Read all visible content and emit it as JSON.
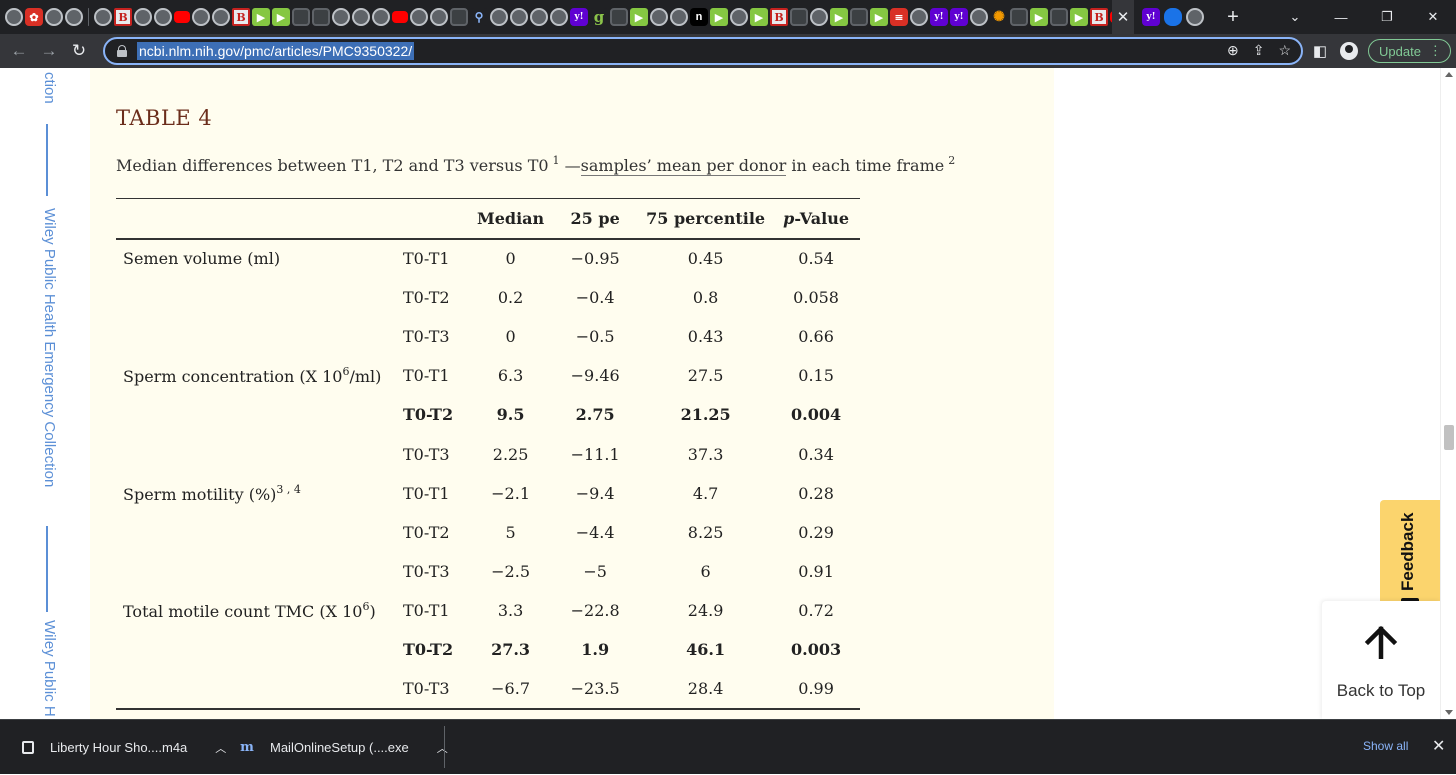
{
  "browser": {
    "url": "ncbi.nlm.nih.gov/pmc/articles/PMC9350322/",
    "update_label": "Update",
    "window_controls": [
      "⌄",
      "—",
      "❐",
      "✕"
    ],
    "new_tab_label": "+",
    "active_tab_close": "✕"
  },
  "sidebar": {
    "label_top": "ction",
    "label_mid": "Wiley Public Health Emergency Collection",
    "label_bottom": "Wiley Public H"
  },
  "article": {
    "table_title": "TABLE 4",
    "caption": {
      "text_before": "Median differences between T1, T2 and T3 versus T0",
      "sup1": "1",
      "dash": " —",
      "link": "samples’ mean per donor",
      "text_after": " in each time frame",
      "sup2": "2"
    },
    "table": {
      "headers": {
        "param": "",
        "timepoint": "",
        "median": "Median",
        "p25": "25 pe",
        "p75": "75 percentile",
        "pvalue_italic": "p",
        "pvalue_rest": "-Value"
      },
      "rows": [
        {
          "param": "Semen volume (ml)",
          "param_sup": "",
          "param_suffix": "",
          "tp": "T0-T1",
          "median": "0",
          "p25": "−0.95",
          "p75": "0.45",
          "p": "0.54",
          "bold": false
        },
        {
          "param": "",
          "param_sup": "",
          "param_suffix": "",
          "tp": "T0-T2",
          "median": "0.2",
          "p25": "−0.4",
          "p75": "0.8",
          "p": "0.058",
          "bold": false
        },
        {
          "param": "",
          "param_sup": "",
          "param_suffix": "",
          "tp": "T0-T3",
          "median": "0",
          "p25": "−0.5",
          "p75": "0.43",
          "p": "0.66",
          "bold": false
        },
        {
          "param": "Sperm concentration (X 10",
          "param_sup": "6",
          "param_suffix": "/ml)",
          "tp": "T0-T1",
          "median": "6.3",
          "p25": "−9.46",
          "p75": "27.5",
          "p": "0.15",
          "bold": false
        },
        {
          "param": "",
          "param_sup": "",
          "param_suffix": "",
          "tp": "T0-T2",
          "median": "9.5",
          "p25": "2.75",
          "p75": "21.25",
          "p": "0.004",
          "bold": true
        },
        {
          "param": "",
          "param_sup": "",
          "param_suffix": "",
          "tp": "T0-T3",
          "median": "2.25",
          "p25": "−11.1",
          "p75": "37.3",
          "p": "0.34",
          "bold": false
        },
        {
          "param": "Sperm motility (%)",
          "param_sup": "3 , 4",
          "param_suffix": "",
          "tp": "T0-T1",
          "median": "−2.1",
          "p25": "−9.4",
          "p75": "4.7",
          "p": "0.28",
          "bold": false
        },
        {
          "param": "",
          "param_sup": "",
          "param_suffix": "",
          "tp": "T0-T2",
          "median": "5",
          "p25": "−4.4",
          "p75": "8.25",
          "p": "0.29",
          "bold": false
        },
        {
          "param": "",
          "param_sup": "",
          "param_suffix": "",
          "tp": "T0-T3",
          "median": "−2.5",
          "p25": "−5",
          "p75": "6",
          "p": "0.91",
          "bold": false
        },
        {
          "param": "Total motile count TMC (X 10",
          "param_sup": "6",
          "param_suffix": ")",
          "tp": "T0-T1",
          "median": "3.3",
          "p25": "−22.8",
          "p75": "24.9",
          "p": "0.72",
          "bold": false
        },
        {
          "param": "",
          "param_sup": "",
          "param_suffix": "",
          "tp": "T0-T2",
          "median": "27.3",
          "p25": "1.9",
          "p75": "46.1",
          "p": "0.003",
          "bold": true
        },
        {
          "param": "",
          "param_sup": "",
          "param_suffix": "",
          "tp": "T0-T3",
          "median": "−6.7",
          "p25": "−23.5",
          "p75": "28.4",
          "p": "0.99",
          "bold": false
        }
      ]
    }
  },
  "widgets": {
    "feedback_label": "Feedback",
    "back_to_top_label": "Back to Top"
  },
  "downloads": {
    "items": [
      {
        "name": "Liberty Hour Sho....m4a",
        "icon": "media-file-icon"
      },
      {
        "name": "MailOnlineSetup (....exe",
        "icon": "mailonline-icon"
      }
    ],
    "show_all_label": "Show all",
    "close_label": "✕"
  },
  "colors": {
    "content_bg": "#fffdef",
    "title_color": "#6b2d1b",
    "sidebar_link": "#5b8fd6",
    "feedback_bg": "#fbd46d",
    "omnibox_focus": "#8ab4f8"
  }
}
